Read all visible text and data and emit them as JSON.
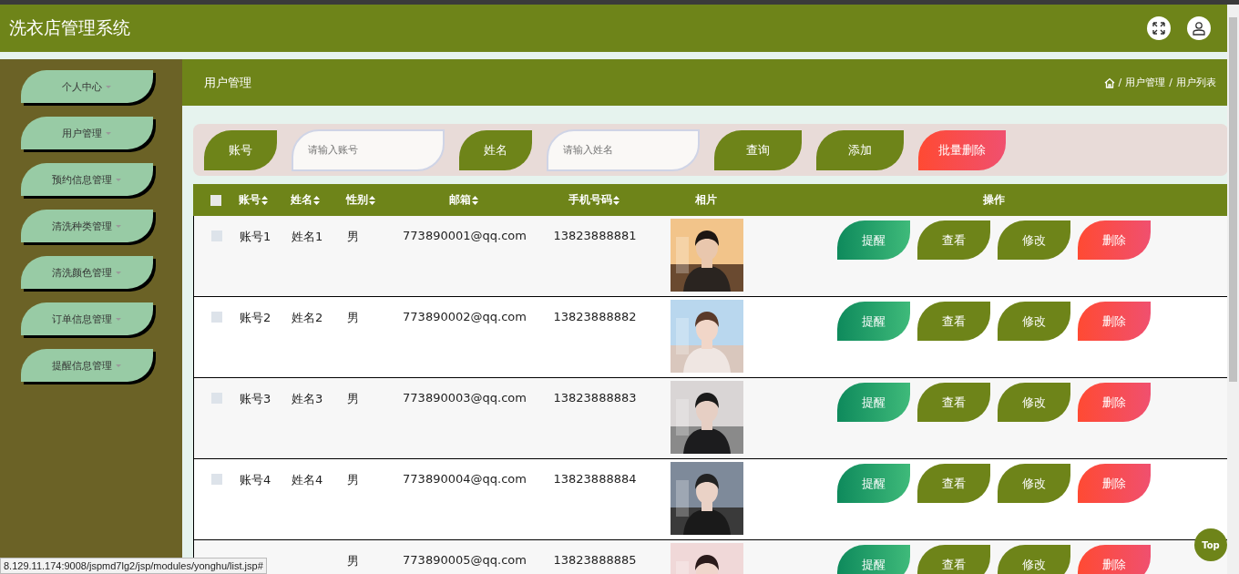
{
  "app_title": "洗衣店管理系统",
  "sidebar": {
    "items": [
      {
        "label": "个人中心",
        "expanded": false
      },
      {
        "label": "用户管理",
        "expanded": false
      },
      {
        "label": "预约信息管理",
        "expanded": false
      },
      {
        "label": "清洗种类管理",
        "expanded": false
      },
      {
        "label": "清洗颜色管理",
        "expanded": false
      },
      {
        "label": "订单信息管理",
        "expanded": false
      },
      {
        "label": "提醒信息管理",
        "expanded": false
      }
    ]
  },
  "page_header": {
    "title": "用户管理",
    "breadcrumb": [
      {
        "separator": "/",
        "label": "用户管理"
      },
      {
        "separator": "/",
        "label": "用户列表"
      }
    ]
  },
  "search": {
    "fields": [
      {
        "label": "账号",
        "placeholder": "请输入账号"
      },
      {
        "label": "姓名",
        "placeholder": "请输入姓名"
      }
    ],
    "buttons": [
      {
        "label": "查询",
        "kind": "normal"
      },
      {
        "label": "添加",
        "kind": "normal"
      },
      {
        "label": "批量删除",
        "kind": "danger"
      }
    ]
  },
  "table": {
    "columns": [
      {
        "label": "账号",
        "sortable": true
      },
      {
        "label": "姓名",
        "sortable": true
      },
      {
        "label": "性别",
        "sortable": true
      },
      {
        "label": "邮箱",
        "sortable": true
      },
      {
        "label": "手机号码",
        "sortable": true
      },
      {
        "label": "相片",
        "sortable": false
      },
      {
        "label": "操作",
        "sortable": false
      }
    ],
    "all_checked": false,
    "rows": [
      {
        "checked": false,
        "account": "账号1",
        "name": "姓名1",
        "gender": "男",
        "email": "773890001@qq.com",
        "phone": "13823888881",
        "photo": {
          "kind": "picture"
        },
        "actions": [
          {
            "label": "提醒",
            "kind": "remind"
          },
          {
            "label": "查看",
            "kind": "normal"
          },
          {
            "label": "修改",
            "kind": "normal"
          },
          {
            "label": "删除",
            "kind": "danger"
          }
        ]
      },
      {
        "checked": false,
        "account": "账号2",
        "name": "姓名2",
        "gender": "男",
        "email": "773890002@qq.com",
        "phone": "13823888882",
        "photo": {
          "kind": "picture"
        },
        "actions": [
          {
            "label": "提醒",
            "kind": "remind"
          },
          {
            "label": "查看",
            "kind": "normal"
          },
          {
            "label": "修改",
            "kind": "normal"
          },
          {
            "label": "删除",
            "kind": "danger"
          }
        ]
      },
      {
        "checked": false,
        "account": "账号3",
        "name": "姓名3",
        "gender": "男",
        "email": "773890003@qq.com",
        "phone": "13823888883",
        "photo": {
          "kind": "picture"
        },
        "actions": [
          {
            "label": "提醒",
            "kind": "remind"
          },
          {
            "label": "查看",
            "kind": "normal"
          },
          {
            "label": "修改",
            "kind": "normal"
          },
          {
            "label": "删除",
            "kind": "danger"
          }
        ]
      },
      {
        "checked": false,
        "account": "账号4",
        "name": "姓名4",
        "gender": "男",
        "email": "773890004@qq.com",
        "phone": "13823888884",
        "photo": {
          "kind": "picture"
        },
        "actions": [
          {
            "label": "提醒",
            "kind": "remind"
          },
          {
            "label": "查看",
            "kind": "normal"
          },
          {
            "label": "修改",
            "kind": "normal"
          },
          {
            "label": "删除",
            "kind": "danger"
          }
        ]
      },
      {
        "gender": "男",
        "email": "773890005@qq.com",
        "phone": "13823888885",
        "photo": {
          "kind": "picture"
        },
        "actions": [
          {
            "label": "提醒",
            "kind": "remind"
          },
          {
            "label": "查看",
            "kind": "normal"
          },
          {
            "label": "修改",
            "kind": "normal"
          },
          {
            "label": "删除",
            "kind": "danger"
          }
        ]
      }
    ]
  },
  "top_button": "Top",
  "status_url": "8.129.11.174:9008/jspmd7lg2/jsp/modules/yonghu/list.jsp#"
}
